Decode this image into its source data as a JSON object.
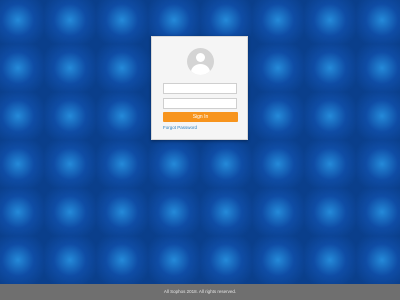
{
  "login": {
    "username_value": "",
    "password_value": "",
    "signin_label": "Sign In",
    "forgot_label": "Forgot Password"
  },
  "footer": {
    "copyright": "All rights reserved.",
    "prefix": "All",
    "company": "Sophos",
    "year": "2018."
  },
  "icons": {
    "avatar": "user-avatar-icon"
  },
  "colors": {
    "accent": "#f7941d",
    "link": "#2a7fc1",
    "background": "#0a3f8c",
    "footer": "#6f6f6f"
  }
}
